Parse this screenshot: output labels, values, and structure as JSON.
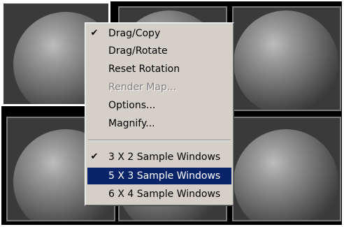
{
  "context_menu": {
    "items": [
      {
        "label": "Drag/Copy",
        "checked": true,
        "disabled": false
      },
      {
        "label": "Drag/Rotate",
        "checked": false,
        "disabled": false
      },
      {
        "label": "Reset Rotation",
        "checked": false,
        "disabled": false
      },
      {
        "label": "Render Map...",
        "checked": false,
        "disabled": true
      },
      {
        "label": "Options...",
        "checked": false,
        "disabled": false
      },
      {
        "label": "Magnify...",
        "checked": false,
        "disabled": false
      }
    ],
    "layout_items": [
      {
        "label": "3 X 2 Sample Windows",
        "checked": true,
        "selected": false
      },
      {
        "label": "5 X 3 Sample Windows",
        "checked": false,
        "selected": true
      },
      {
        "label": "6 X 4 Sample Windows",
        "checked": false,
        "selected": false
      }
    ],
    "check_glyph": "✔",
    "highlight_color": "#0a246a"
  },
  "sample_grid": {
    "columns": 3,
    "rows": 2,
    "active_slot": 1
  }
}
